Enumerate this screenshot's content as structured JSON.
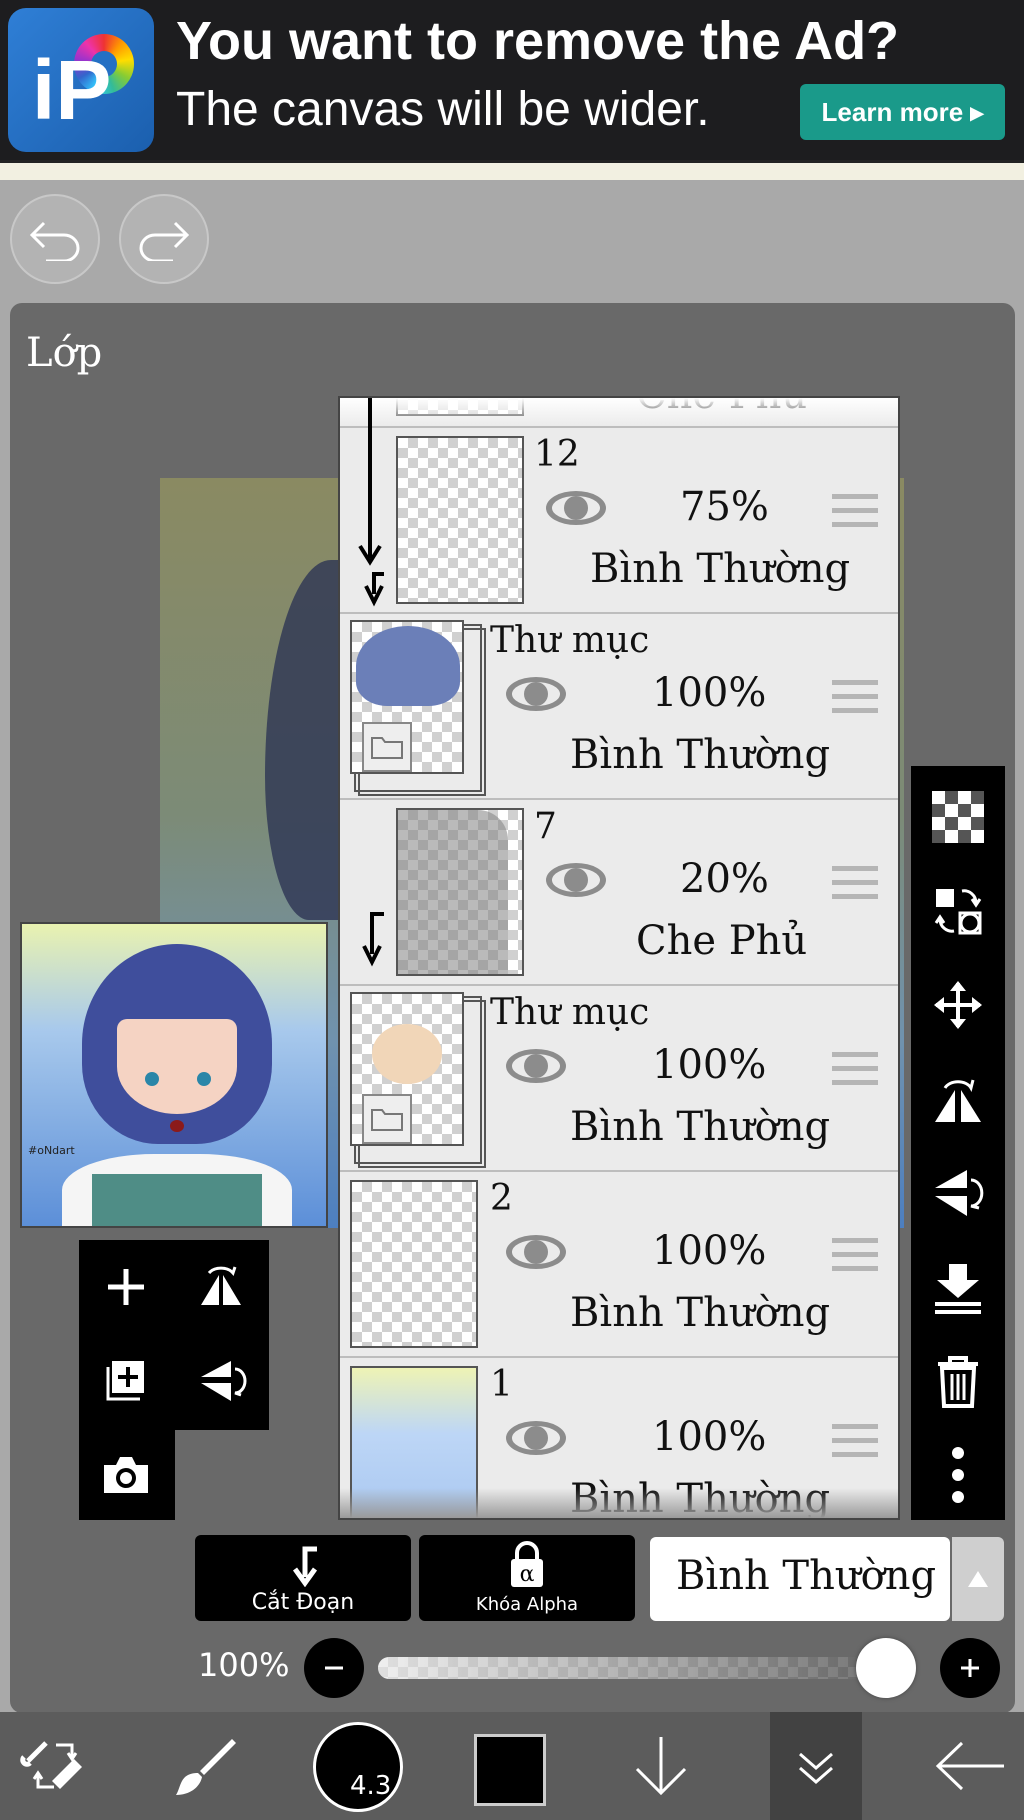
{
  "ad": {
    "title": "You want to remove the Ad?",
    "subtitle": "The canvas will be wider.",
    "cta": "Learn more ▸"
  },
  "panel": {
    "title": "Lớp"
  },
  "layers": [
    {
      "name": "",
      "opacity": "",
      "mode": "Che Phủ"
    },
    {
      "name": "12",
      "opacity": "75%",
      "mode": "Bình Thường"
    },
    {
      "name": "Thư mục",
      "opacity": "100%",
      "mode": "Bình Thường"
    },
    {
      "name": "7",
      "opacity": "20%",
      "mode": "Che Phủ"
    },
    {
      "name": "Thư mục",
      "opacity": "100%",
      "mode": "Bình Thường"
    },
    {
      "name": "2",
      "opacity": "100%",
      "mode": "Bình Thường"
    },
    {
      "name": "1",
      "opacity": "100%",
      "mode": "Bình Thường"
    }
  ],
  "bottom": {
    "clip_label": "Cắt Đoạn",
    "alpha_label": "Khóa Alpha",
    "blend_mode": "Bình Thường",
    "opacity_label": "100%",
    "opacity_value": 1.0
  },
  "appbar": {
    "brush_size": "4.3",
    "color": "#000000"
  },
  "thumbnail": {
    "signature": "#oNdart"
  }
}
